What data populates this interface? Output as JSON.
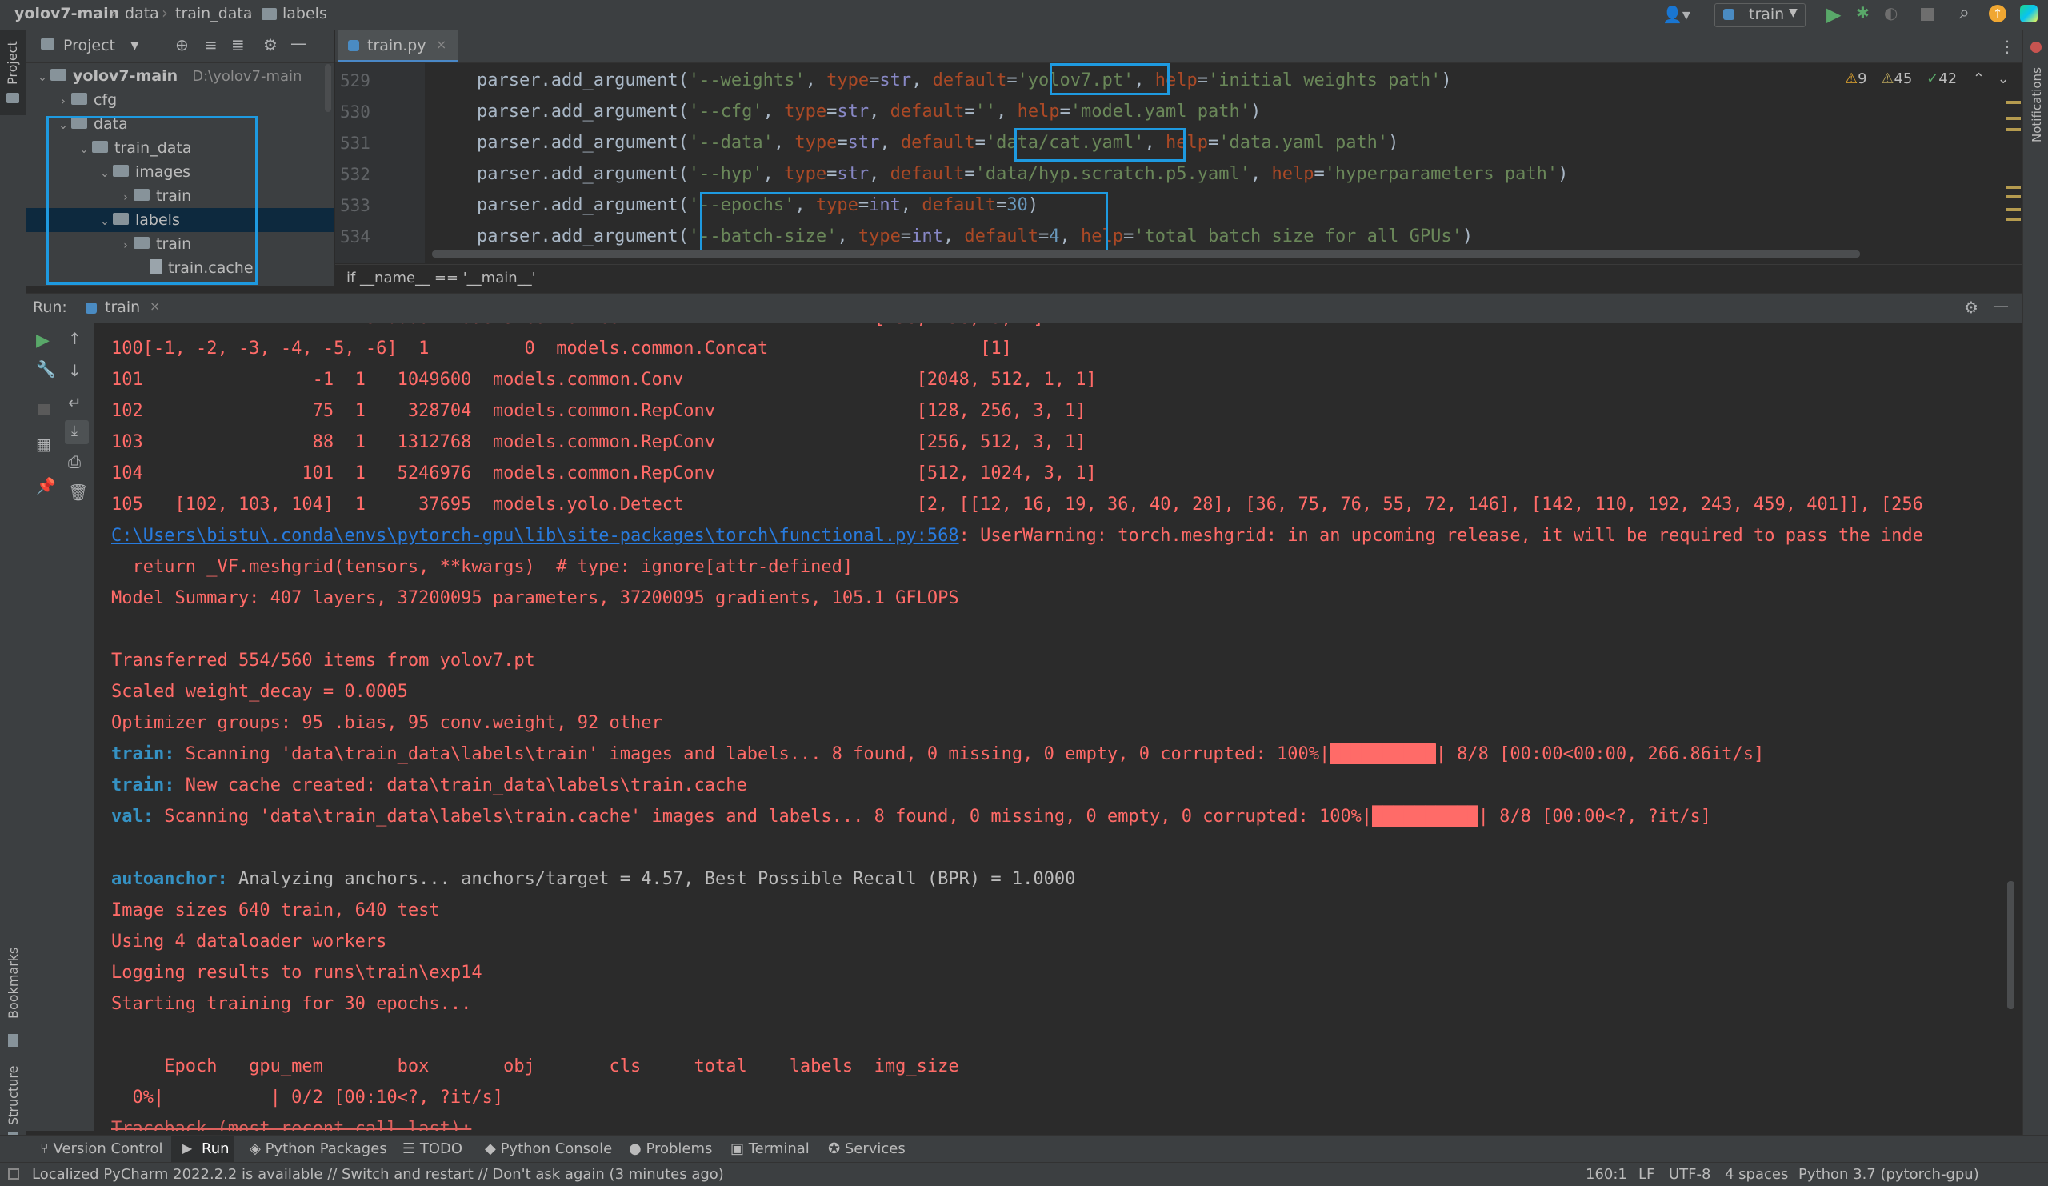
{
  "navbar": {
    "crumbs": [
      "yolov7-main",
      "data",
      "train_data",
      "labels"
    ],
    "run_config": "train"
  },
  "left_strip": {
    "project_label": "Project",
    "bookmarks_label": "Bookmarks",
    "structure_label": "Structure"
  },
  "right_strip": {
    "notifications_label": "Notifications"
  },
  "project_panel": {
    "title": "Project",
    "tree": [
      {
        "label": "yolov7-main",
        "path": "D:\\yolov7-main"
      },
      {
        "label": "cfg"
      },
      {
        "label": "data"
      },
      {
        "label": "train_data"
      },
      {
        "label": "images"
      },
      {
        "label": "train"
      },
      {
        "label": "labels"
      },
      {
        "label": "train"
      },
      {
        "label": "train.cache"
      }
    ]
  },
  "editor": {
    "tab_label": "train.py",
    "inspections": {
      "warnings": "9",
      "weak_warnings": "45",
      "ok": "42"
    },
    "line_numbers": [
      "529",
      "530",
      "531",
      "532",
      "533",
      "534"
    ],
    "breadcrumb": "if __name__ == '__main__'"
  },
  "run_panel": {
    "label": "Run:",
    "tab_label": "train"
  },
  "console": {
    "lines": [
      "100[-1, -2, -3, -4, -5, -6]  1         0  models.common.Concat                    [1]",
      "101                -1  1   1049600  models.common.Conv                      [2048, 512, 1, 1]",
      "102                75  1    328704  models.common.RepConv                   [128, 256, 3, 1]",
      "103                88  1   1312768  models.common.RepConv                   [256, 512, 3, 1]",
      "104               101  1   5246976  models.common.RepConv                   [512, 1024, 3, 1]",
      "105   [102, 103, 104]  1     37695  models.yolo.Detect                      [2, [[12, 16, 19, 36, 40, 28], [36, 75, 76, 55, 72, 146], [142, 110, 192, 243, 459, 401]], [256"
    ],
    "warning_link": "C:\\Users\\bistu\\.conda\\envs\\pytorch-gpu\\lib\\site-packages\\torch\\functional.py:568",
    "warning_text": ": UserWarning: torch.meshgrid: in an upcoming release, it will be required to pass the inde",
    "warning_line2": "  return _VF.meshgrid(tensors, **kwargs)  # type: ignore[attr-defined]",
    "summary": "Model Summary: 407 layers, 37200095 parameters, 37200095 gradients, 105.1 GFLOPS",
    "transferred": "Transferred 554/560 items from yolov7.pt",
    "scaled": "Scaled weight_decay = 0.0005",
    "optimizer": "Optimizer groups: 95 .bias, 95 conv.weight, 92 other",
    "train_prefix": "train:",
    "train_scan": " Scanning 'data\\train_data\\labels\\train' images and labels... 8 found, 0 missing, 0 empty, 0 corrupted: 100%|",
    "train_scan_tail": "| 8/8 [00:00<00:00, 266.86it/s]",
    "train_cache": " New cache created: data\\train_data\\labels\\train.cache",
    "val_prefix": "val:",
    "val_scan": " Scanning 'data\\train_data\\labels\\train.cache' images and labels... 8 found, 0 missing, 0 empty, 0 corrupted: 100%|",
    "val_scan_tail": "| 8/8 [00:00<?, ?it/s]",
    "progress_fraction": 1.0,
    "autoanchor_prefix": "autoanchor:",
    "autoanchor_text": " Analyzing anchors... anchors/target = 4.57, Best Possible Recall (BPR) = 1.0000",
    "image_sizes": "Image sizes 640 train, 640 test",
    "workers": "Using 4 dataloader workers",
    "logging": "Logging results to runs\\train\\exp14",
    "starting": "Starting training for 30 epochs...",
    "header": "     Epoch   gpu_mem       box       obj       cls     total    labels  img_size",
    "progress0": "  0%|          | 0/2 [00:10<?, ?it/s]",
    "traceback": "Traceback (most recent call last):"
  },
  "bottom_tabs": [
    "Version Control",
    "Run",
    "Python Packages",
    "TODO",
    "Python Console",
    "Problems",
    "Terminal",
    "Services"
  ],
  "status": {
    "message": "Localized PyCharm 2022.2.2 is available // Switch and restart // Don't ask again (3 minutes ago)",
    "position": "160:1",
    "line_sep": "LF",
    "encoding": "UTF-8",
    "indent": "4 spaces",
    "interpreter": "Python 3.7 (pytorch-gpu)"
  },
  "colors": {
    "accent": "#1e9ae0",
    "console_text": "#ff6b68",
    "keyword_blue": "#3592c4"
  }
}
